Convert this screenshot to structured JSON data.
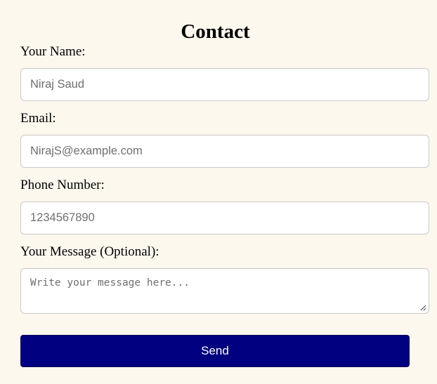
{
  "form": {
    "title": "Contact",
    "name_label": "Your Name:",
    "name_placeholder": "Niraj Saud",
    "email_label": "Email:",
    "email_placeholder": "NirajS@example.com",
    "phone_label": "Phone Number:",
    "phone_placeholder": "1234567890",
    "message_label": "Your Message (Optional):",
    "message_placeholder": "Write your message here...",
    "send_label": "Send"
  },
  "colors": {
    "page_background": "#fdf8ee",
    "button_background": "#000080",
    "button_text": "#ffffff",
    "input_border": "#c9c9c9"
  },
  "icons": {
    "textarea_resize": "resize-grip-icon"
  }
}
